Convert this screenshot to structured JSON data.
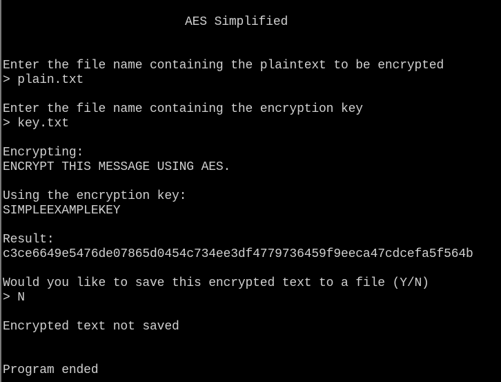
{
  "console": {
    "title": "AES Simplified",
    "lines": [
      "Enter the file name containing the plaintext to be encrypted",
      "> plain.txt",
      "Enter the file name containing the encryption key",
      "> key.txt",
      "Encrypting:",
      "ENCRYPT THIS MESSAGE USING AES.",
      "Using the encryption key:",
      "SIMPLEEXAMPLEKEY",
      "Result:",
      "c3ce6649e5476de07865d0454c734ee3df4779736459f9eeca47cdcefa5f564b",
      "Would you like to save this encrypted text to a file (Y/N)",
      "> N",
      "Encrypted text not saved",
      "Program ended"
    ]
  },
  "colors": {
    "background": "#000000",
    "text": "#d0d0d0"
  }
}
